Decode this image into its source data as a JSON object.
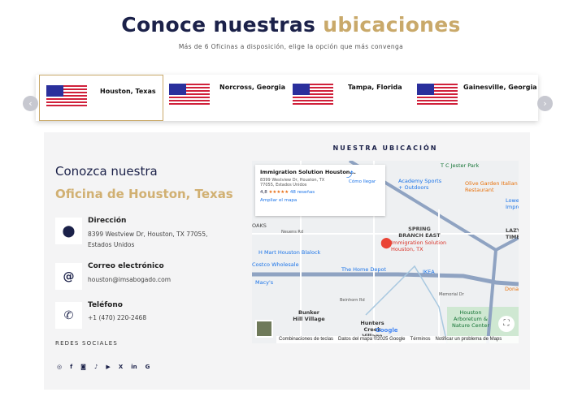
{
  "header": {
    "title_a": "Conoce nuestras",
    "title_b": "ubicaciones",
    "subtitle": "Más de 6 Oficinas a disposición, elige la opción que más convenga"
  },
  "locations": [
    {
      "name": "Houston, Texas",
      "active": true
    },
    {
      "name": "Norcross, Georgia"
    },
    {
      "name": "Tampa, Florida"
    },
    {
      "name": "Gainesville, Georgia"
    }
  ],
  "carousel": {
    "prev_icon": "chevron-left-icon",
    "next_icon": "chevron-right-icon",
    "prev": "‹",
    "next": "›"
  },
  "office": {
    "heading": "Conozca nuestra",
    "name": "Oficina de Houston, Texas",
    "address_label": "Dirección",
    "address_line1": "8399 Westview Dr, Houston, TX 77055,",
    "address_line2": "Estados Unidos",
    "email_label": "Correo electrónico",
    "email": "houston@imsabogado.com",
    "phone_label": "Teléfono",
    "phone": "+1 (470) 220-2468",
    "social_label": "REDES SOCIALES",
    "social": [
      "whatsapp",
      "facebook",
      "instagram",
      "tiktok",
      "youtube",
      "x",
      "linkedin",
      "google"
    ],
    "social_glyphs": [
      "◎",
      "f",
      "◙",
      "♪",
      "▶",
      "X",
      "in",
      "G"
    ]
  },
  "map": {
    "title": "NUESTRA UBICACIÓN",
    "card": {
      "name": "Immigration Solution Houston...",
      "address": "8399 Westview Dr, Houston, TX 77055, Estados Unidos",
      "rating": "4,8",
      "stars": "★★★★★",
      "reviews": "48 reseñas",
      "enlarge": "Ampliar el mapa",
      "directions": "Cómo llegar"
    },
    "pin_label": "Immigration Solution Houston, TX",
    "labels": [
      "T C Jester Park",
      "Academy Sports + Outdoors",
      "Olive Garden Italian Restaurant",
      "Lowe's Impro",
      "SPRING BRANCH EAST",
      "LAZYB TIMBE",
      "H Mart Houston Blalock",
      "Costco Wholesale",
      "The Home Depot",
      "IKEA",
      "Macy's",
      "Memorial Dr",
      "Beinhorn Rd",
      "Neuens Rd",
      "Bunker Hill Village",
      "Hunters Creek Village",
      "Houston Arboretum & Nature Center",
      "OAKS",
      "Dona"
    ],
    "footer": [
      "Combinaciones de teclas",
      "Datos del mapa ©2025 Google",
      "Términos",
      "Notificar un problema de Maps"
    ],
    "google": "Google"
  }
}
